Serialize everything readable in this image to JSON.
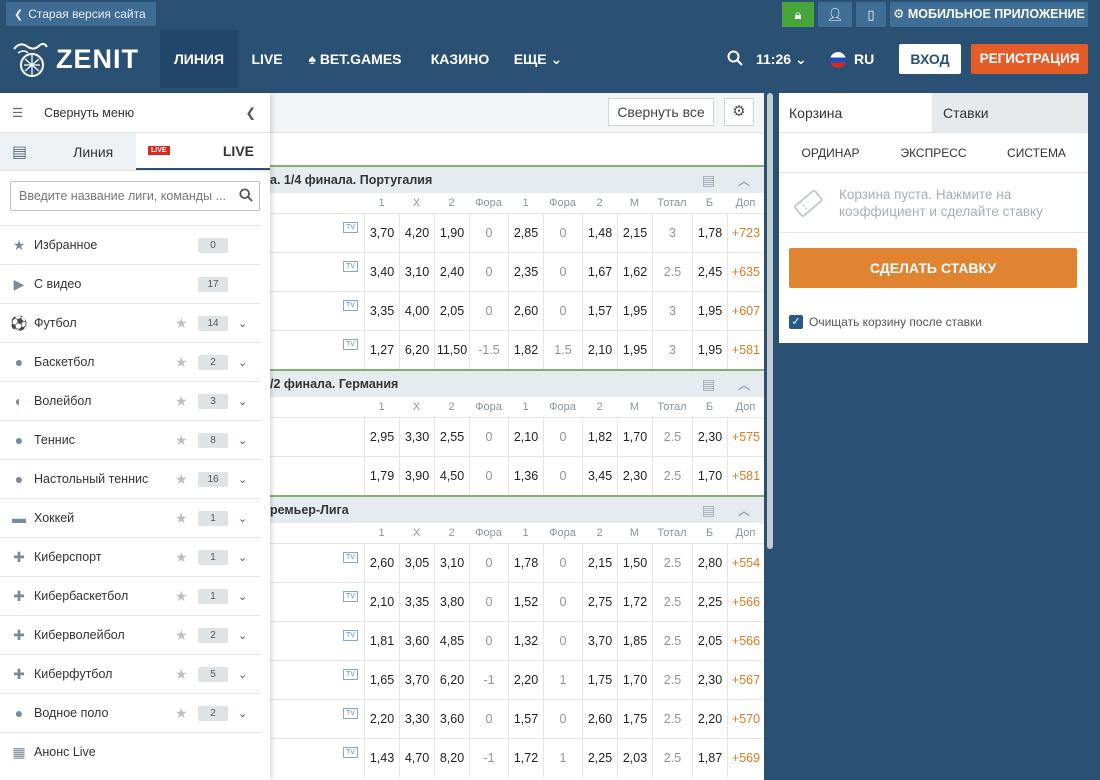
{
  "topbar": {
    "old_version": "Старая версия сайта",
    "mobile_app": "МОБИЛЬНОЕ ПРИЛОЖЕНИЕ"
  },
  "header": {
    "brand": "ZENIT",
    "nav": [
      "ЛИНИЯ",
      "LIVE",
      "BET.GAMES",
      "КАЗИНО",
      "ЕЩЕ"
    ],
    "time": "11:26",
    "lang": "RU",
    "login": "ВХОД",
    "register": "РЕГИСТРАЦИЯ"
  },
  "sidebar": {
    "collapse_label": "Свернуть меню",
    "tab_line": "Линия",
    "tab_live_badge": "LIVE",
    "tab_live": "LIVE",
    "search_placeholder": "Введите название лиги, команды ...",
    "items": [
      {
        "name": "Избранное",
        "count": "0",
        "icon": "star-icon"
      },
      {
        "name": "С видео",
        "count": "17",
        "icon": "video-icon"
      },
      {
        "name": "Футбол",
        "count": "14",
        "icon": "football-icon"
      },
      {
        "name": "Баскетбол",
        "count": "2",
        "icon": "basketball-icon"
      },
      {
        "name": "Волейбол",
        "count": "3",
        "icon": "volleyball-icon"
      },
      {
        "name": "Теннис",
        "count": "8",
        "icon": "tennis-icon"
      },
      {
        "name": "Настольный теннис",
        "count": "16",
        "icon": "table-tennis-icon"
      },
      {
        "name": "Хоккей",
        "count": "1",
        "icon": "hockey-icon"
      },
      {
        "name": "Киберспорт",
        "count": "1",
        "icon": "gamepad-icon"
      },
      {
        "name": "Кибербаскетбол",
        "count": "1",
        "icon": "gamepad-icon"
      },
      {
        "name": "Кибер­волейбол",
        "count": "2",
        "icon": "gamepad-icon"
      },
      {
        "name": "Киберфутбол",
        "count": "5",
        "icon": "gamepad-icon"
      },
      {
        "name": "Водное поло",
        "count": "2",
        "icon": "water-polo-icon"
      },
      {
        "name": "Анонс Live",
        "count": "",
        "icon": "calendar-icon"
      }
    ]
  },
  "main": {
    "collapse_all": "Свернуть все",
    "columns": [
      "1",
      "X",
      "2",
      "Фора",
      "1",
      "Фора",
      "2",
      "М",
      "Тотал",
      "Б",
      "Доп"
    ],
    "leagues": [
      {
        "title": "а. 1/4 финала. Португалия",
        "rows": [
          {
            "tv": true,
            "odds": [
              "3,70",
              "4,20",
              "1,90",
              "0",
              "2,85",
              "0",
              "1,48",
              "2,15",
              "3",
              "1,78",
              "+723"
            ]
          },
          {
            "tv": true,
            "odds": [
              "3,40",
              "3,10",
              "2,40",
              "0",
              "2,35",
              "0",
              "1,67",
              "1,62",
              "2.5",
              "2,45",
              "+635"
            ]
          },
          {
            "tv": true,
            "odds": [
              "3,35",
              "4,00",
              "2,05",
              "0",
              "2,60",
              "0",
              "1,57",
              "1,95",
              "3",
              "1,95",
              "+607"
            ]
          },
          {
            "tv": true,
            "odds": [
              "1,27",
              "6,20",
              "11,50",
              "-1.5",
              "1,82",
              "1.5",
              "2,10",
              "1,95",
              "3",
              "1,95",
              "+581"
            ]
          }
        ]
      },
      {
        "title": "/2 финала. Германия",
        "rows": [
          {
            "tv": false,
            "odds": [
              "2,95",
              "3,30",
              "2,55",
              "0",
              "2,10",
              "0",
              "1,82",
              "1,70",
              "2.5",
              "2,30",
              "+575"
            ]
          },
          {
            "tv": false,
            "odds": [
              "1,79",
              "3,90",
              "4,50",
              "0",
              "1,36",
              "0",
              "3,45",
              "2,30",
              "2.5",
              "1,70",
              "+581"
            ]
          }
        ]
      },
      {
        "title": "ремьер-Лига",
        "rows": [
          {
            "tv": true,
            "odds": [
              "2,60",
              "3,05",
              "3,10",
              "0",
              "1,78",
              "0",
              "2,15",
              "1,50",
              "2.5",
              "2,80",
              "+554"
            ]
          },
          {
            "tv": true,
            "odds": [
              "2,10",
              "3,35",
              "3,80",
              "0",
              "1,52",
              "0",
              "2,75",
              "1,72",
              "2.5",
              "2,25",
              "+566"
            ]
          },
          {
            "tv": true,
            "odds": [
              "1,81",
              "3,60",
              "4,85",
              "0",
              "1,32",
              "0",
              "3,70",
              "1,85",
              "2.5",
              "2,05",
              "+566"
            ]
          },
          {
            "tv": true,
            "odds": [
              "1,65",
              "3,70",
              "6,20",
              "-1",
              "2,20",
              "1",
              "1,75",
              "1,70",
              "2.5",
              "2,30",
              "+567"
            ]
          },
          {
            "tv": true,
            "odds": [
              "2,20",
              "3,30",
              "3,60",
              "0",
              "1,57",
              "0",
              "2,60",
              "1,75",
              "2.5",
              "2,20",
              "+570"
            ]
          },
          {
            "tv": true,
            "odds": [
              "1,43",
              "4,70",
              "8,20",
              "-1",
              "1,72",
              "1",
              "2,25",
              "2,03",
              "2.5",
              "1,87",
              "+569"
            ]
          }
        ]
      }
    ]
  },
  "basket": {
    "tab_basket": "Корзина",
    "tab_bets": "Ставки",
    "types": [
      "ОРДИНАР",
      "ЭКСПРЕСС",
      "СИСТЕМА"
    ],
    "empty_text": "Корзина пуста. Нажмите на коэффициент и сделайте ставку",
    "make_bet": "СДЕЛАТЬ СТАВКУ",
    "clear_label": "Очищать корзину после ставки"
  },
  "colors": {
    "header_bg": "#2a5174",
    "accent_orange": "#e55c27",
    "bet_button": "#e08432",
    "live_red": "#d9281f",
    "extra_odds": "#e07a22"
  }
}
